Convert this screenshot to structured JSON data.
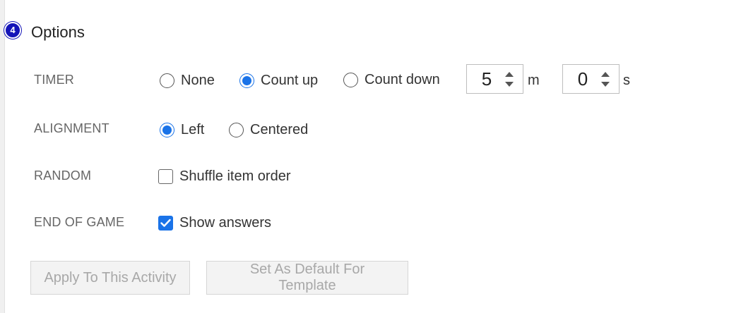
{
  "section": {
    "step": "4",
    "title": "Options"
  },
  "timer": {
    "label": "TIMER",
    "options": [
      "None",
      "Count up",
      "Count down"
    ],
    "selected": "Count up",
    "minutes": "5",
    "minutes_unit": "m",
    "seconds": "0",
    "seconds_unit": "s"
  },
  "alignment": {
    "label": "ALIGNMENT",
    "options": [
      "Left",
      "Centered"
    ],
    "selected": "Left"
  },
  "random": {
    "label": "RANDOM",
    "shuffle_label": "Shuffle item order",
    "shuffle_checked": false
  },
  "end_of_game": {
    "label": "END OF GAME",
    "show_answers_label": "Show answers",
    "show_answers_checked": true
  },
  "buttons": {
    "apply": "Apply To This Activity",
    "set_default": "Set As Default For Template"
  },
  "colors": {
    "accent": "#1a73e8",
    "badge": "#1414b8",
    "disabled_text": "#a8a8a8"
  }
}
